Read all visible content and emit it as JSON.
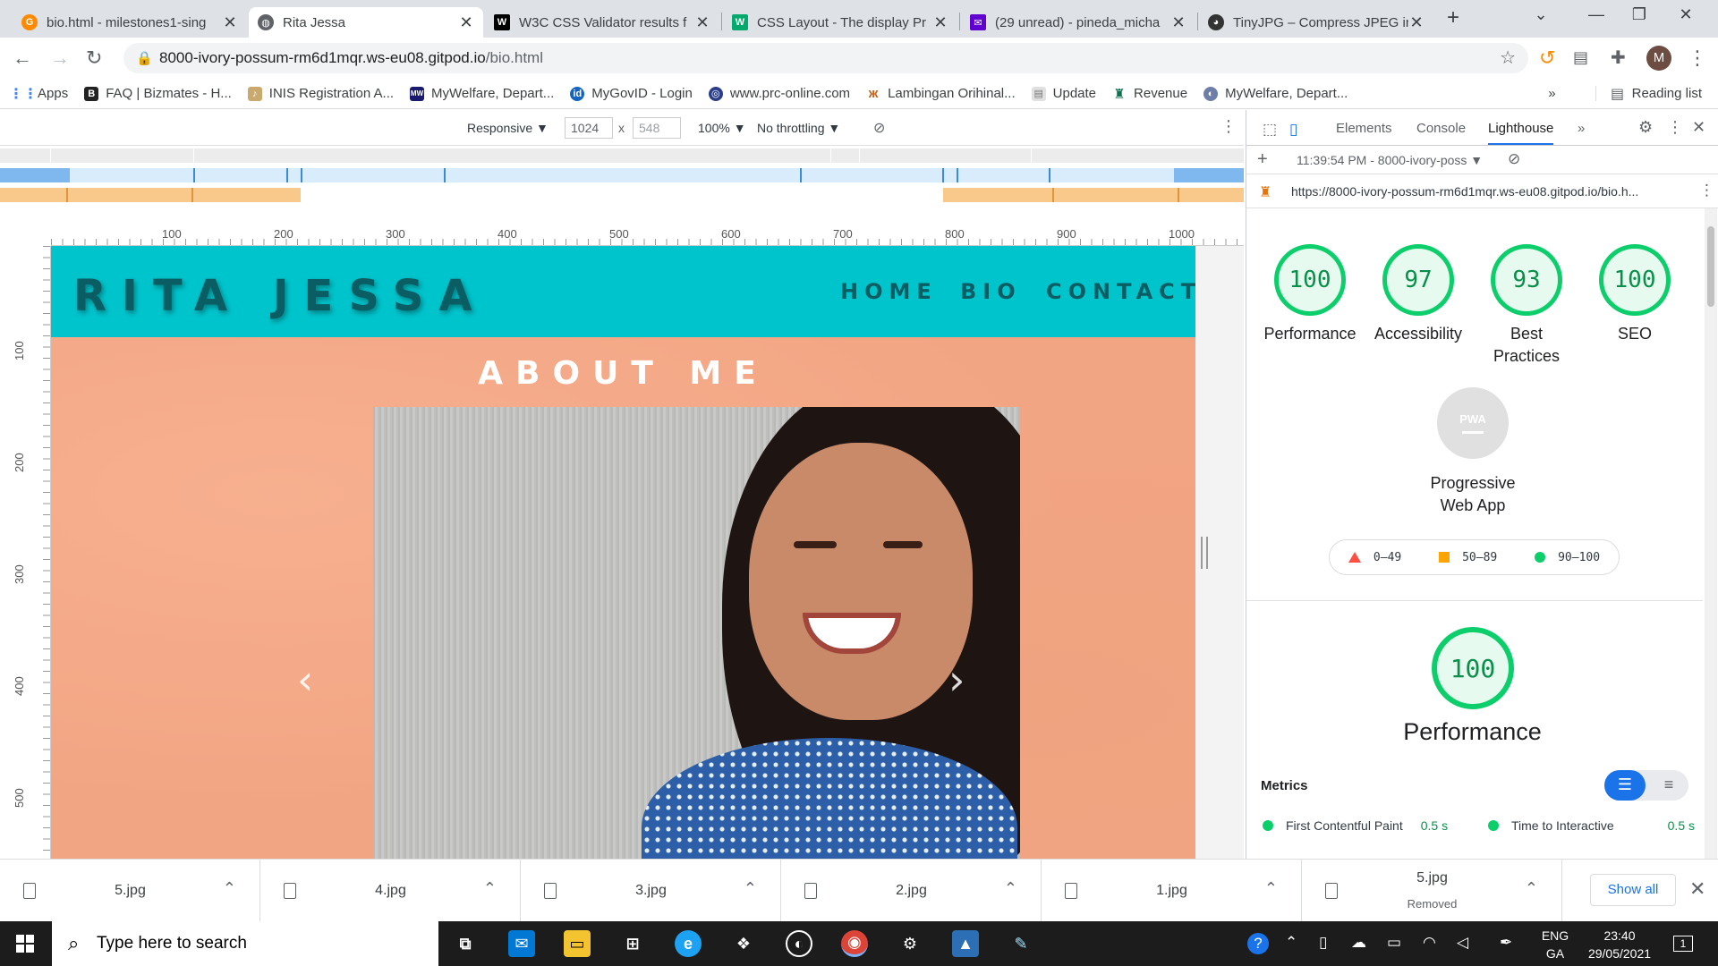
{
  "tabs": [
    {
      "title": "bio.html - milestones1-sing",
      "icon": "gitpod-icon",
      "color": "#ff8a00"
    },
    {
      "title": "Rita Jessa",
      "icon": "globe-icon",
      "color": "#5f6368"
    },
    {
      "title": "W3C CSS Validator results f",
      "icon": "w3c-icon",
      "color": "#000000"
    },
    {
      "title": "CSS Layout - The display Pr",
      "icon": "w3schools-icon",
      "color": "#04aa6d"
    },
    {
      "title": "(29 unread) - pineda_micha",
      "icon": "yahoo-mail-icon",
      "color": "#6001d2"
    },
    {
      "title": "TinyJPG – Compress JPEG in",
      "icon": "panda-icon",
      "color": "#333333"
    }
  ],
  "address": {
    "host": "8000-ivory-possum-rm6d1mqr.ws-eu08.gitpod.io",
    "path": "/bio.html",
    "avatar": "M"
  },
  "bookmarks": [
    {
      "label": "Apps",
      "icon": "apps-grid-icon"
    },
    {
      "label": "FAQ | Bizmates - H...",
      "icon": "bizmates-icon"
    },
    {
      "label": "INIS Registration A...",
      "icon": "harp-icon"
    },
    {
      "label": "MyWelfare, Depart...",
      "icon": "mywelfare-icon"
    },
    {
      "label": "MyGovID - Login",
      "icon": "mygovid-icon"
    },
    {
      "label": "www.prc-online.com",
      "icon": "prc-icon"
    },
    {
      "label": "Lambingan Orihinal...",
      "icon": "butterfly-icon"
    },
    {
      "label": "Update",
      "icon": "page-icon"
    },
    {
      "label": "Revenue",
      "icon": "revenue-icon"
    },
    {
      "label": "MyWelfare, Depart...",
      "icon": "mywelfare-icon"
    }
  ],
  "bookmarks_more": "»",
  "reading_list": "Reading list",
  "device": {
    "mode": "Responsive ▼",
    "width": "1024",
    "times": "x",
    "height": "548",
    "zoom": "100% ▼",
    "throttle": "No throttling ▼"
  },
  "ruler_top": [
    "100",
    "200",
    "300",
    "400",
    "500",
    "600",
    "700",
    "800",
    "900",
    "1000"
  ],
  "ruler_left": [
    "100",
    "200",
    "300",
    "400",
    "500"
  ],
  "site": {
    "brand": "RITA JESSA",
    "nav": [
      "HOME",
      "BIO",
      "CONTACT"
    ],
    "section_title": "ABOUT ME",
    "prev": "‹",
    "next": "›",
    "colors": {
      "header": "#00c4cc",
      "brand": "#0a5d62",
      "about_bg": "#f2a583"
    }
  },
  "devtools": {
    "tabs": [
      "Elements",
      "Console",
      "Lighthouse",
      "»"
    ],
    "report_time": "11:39:54 PM - 8000-ivory-poss ▼",
    "report_url": "https://8000-ivory-possum-rm6d1mqr.ws-eu08.gitpod.io/bio.h...",
    "scores": [
      {
        "value": "100",
        "label": "Performance"
      },
      {
        "value": "97",
        "label": "Accessibility"
      },
      {
        "value": "93",
        "label": "Best Practices"
      },
      {
        "value": "100",
        "label": "SEO"
      }
    ],
    "pwa": {
      "badge": "PWA",
      "label": "Progressive Web App"
    },
    "legend": [
      "0–49",
      "50–89",
      "90–100"
    ],
    "main_score": "100",
    "main_label": "Performance",
    "metrics_title": "Metrics",
    "metrics": [
      {
        "name": "First Contentful Paint",
        "value": "0.5 s"
      },
      {
        "name": "Time to Interactive",
        "value": "0.5 s"
      }
    ],
    "score_color": "#0cce6b"
  },
  "downloads": [
    {
      "name": "5.jpg",
      "sub": ""
    },
    {
      "name": "4.jpg",
      "sub": ""
    },
    {
      "name": "3.jpg",
      "sub": ""
    },
    {
      "name": "2.jpg",
      "sub": ""
    },
    {
      "name": "1.jpg",
      "sub": ""
    },
    {
      "name": "5.jpg",
      "sub": "Removed"
    }
  ],
  "show_all": "Show all",
  "taskbar": {
    "search_placeholder": "Type here to search",
    "lang_top": "ENG",
    "lang_bottom": "GA",
    "time": "23:40",
    "date": "29/05/2021",
    "notifications": "1"
  }
}
